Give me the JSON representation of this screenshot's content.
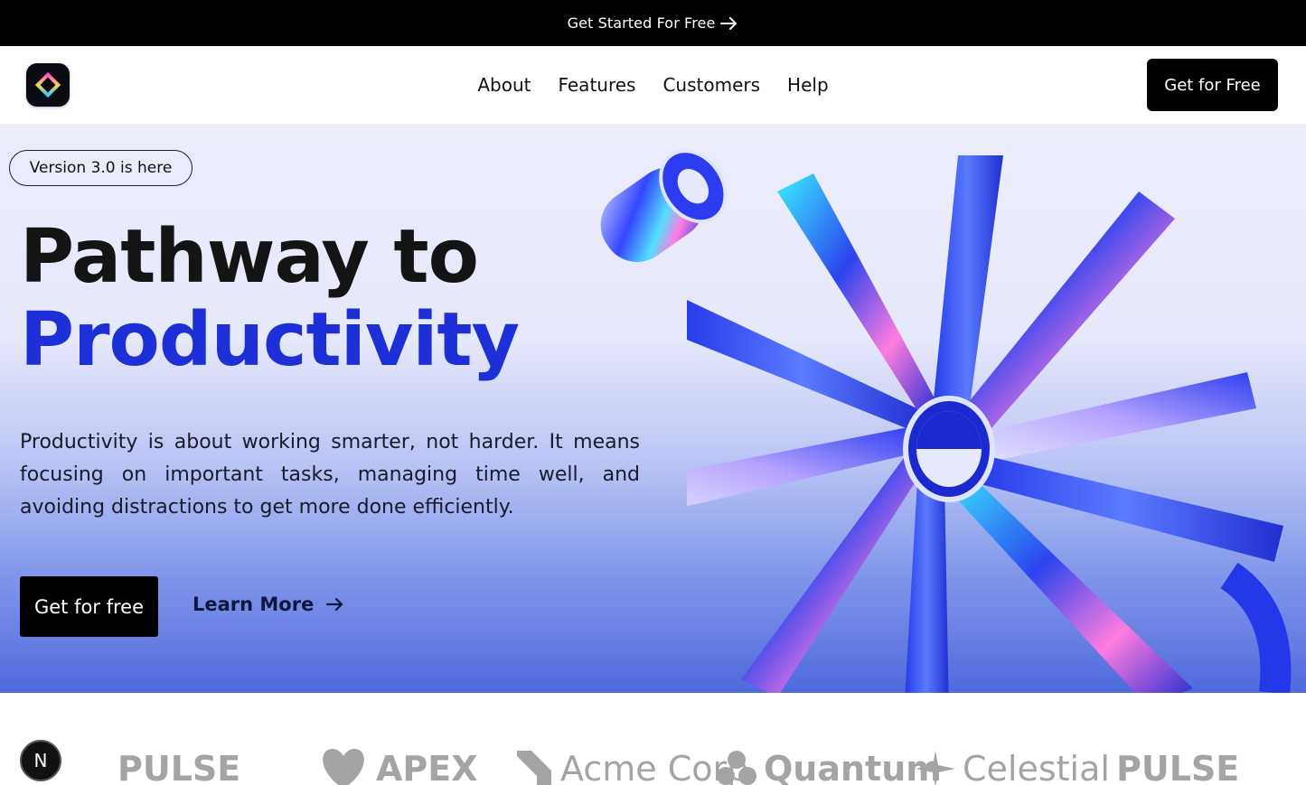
{
  "announcement": {
    "label": "Get Started For Free"
  },
  "nav": {
    "links": [
      "About",
      "Features",
      "Customers",
      "Help"
    ],
    "cta_label": "Get for Free"
  },
  "hero": {
    "badge": "Version 3.0 is here",
    "headline_line1": "Pathway to",
    "headline_line2": "Productivity",
    "description": "Productivity is about working smarter, not harder. It means focusing on important tasks, managing time well, and avoiding distractions to get more done efficiently.",
    "primary_cta": "Get for free",
    "secondary_cta": "Learn More"
  },
  "logos": [
    "PULSE",
    "APEX",
    "Acme Corp",
    "Quantum",
    "Celestial",
    "PULSE"
  ],
  "dev_badge": "N",
  "colors": {
    "accent": "#1d2fd6",
    "dark": "#000000",
    "logo_gray": "#a4a4a4"
  }
}
